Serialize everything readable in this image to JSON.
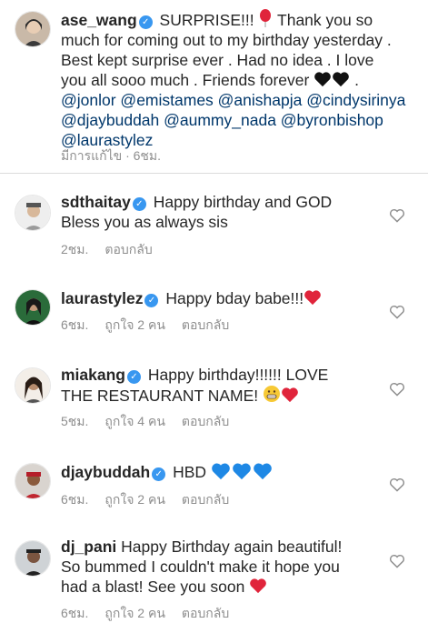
{
  "caption": {
    "username": "ase_wang",
    "text_1": "SURPRISE!!!",
    "text_2": "Thank you so",
    "line_2": "much for coming out to my birthday yesterday .",
    "line_3": "Best kept surprise ever . Had no idea . I love",
    "line_4": "you all sooo much . Friends forever",
    "line_4_end": ".",
    "mentions_line_1": "@jonlor @emistames @anishapja @cindysirinya",
    "mentions_line_2": "@djaybuddah @aummy_nada @byronbishop",
    "mentions_line_3": "@laurastylez",
    "meta": "มีการแก้ไข · 6ชม."
  },
  "comments": [
    {
      "username": "sdthaitay",
      "line_1": "Happy birthday and GOD",
      "line_2": "Bless you as always sis",
      "time": "2ชม.",
      "reply": "ตอบกลับ"
    },
    {
      "username": "laurastylez",
      "line_1": "Happy bday babe!!!",
      "time": "6ชม.",
      "likes": "ถูกใจ 2 คน",
      "reply": "ตอบกลับ"
    },
    {
      "username": "miakang",
      "line_1": "Happy birthday!!!!!! LOVE",
      "line_2": "THE RESTAURANT NAME!",
      "time": "5ชม.",
      "likes": "ถูกใจ 4 คน",
      "reply": "ตอบกลับ"
    },
    {
      "username": "djaybuddah",
      "line_1": "HBD",
      "time": "6ชม.",
      "likes": "ถูกใจ 2 คน",
      "reply": "ตอบกลับ"
    },
    {
      "username": "dj_pani",
      "line_1": "Happy Birthday again beautiful!",
      "line_2": "So bummed I couldn't make it hope you",
      "line_3": "had a blast! See you soon",
      "time": "6ชม.",
      "likes": "ถูกใจ 2 คน",
      "reply": "ตอบกลับ"
    }
  ],
  "colors": {
    "verified": "#3897f0",
    "mention": "#00376b",
    "meta": "#8e8e8e",
    "red_heart": "#e0243b",
    "blue_heart": "#1e88e5"
  },
  "icons": {
    "like": "heart-outline-icon",
    "verified": "verified-badge-icon"
  }
}
